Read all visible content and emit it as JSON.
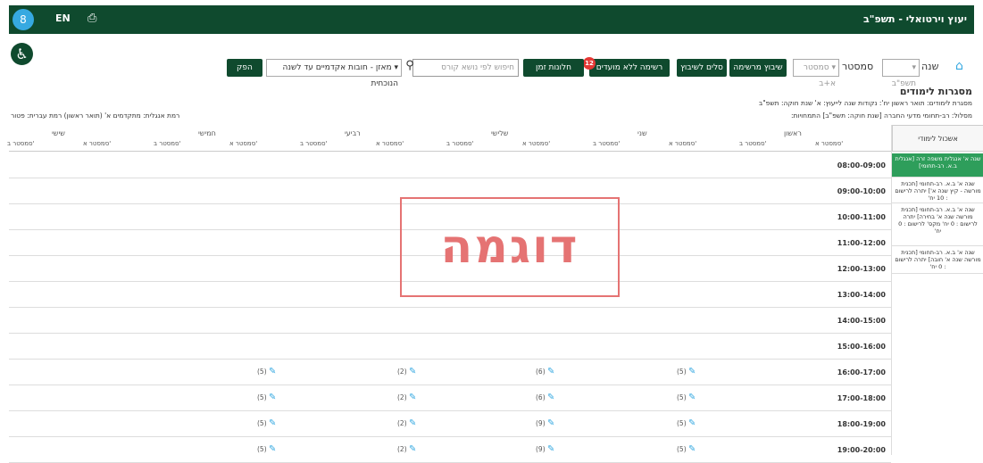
{
  "topbar": {
    "avatar": "8",
    "lang": "EN",
    "app_title": "יעוץ וירטואלי - תשפ\"ב"
  },
  "toolbar": {
    "year_label": "שנה",
    "year_value": "תשפ\"ב",
    "semester_label": "סמסטר",
    "semester_value": "סמסטר א+ב",
    "buttons": [
      "שיבוץ מרשימה",
      "סלים לשיבוץ",
      "רשימה ללא מועדים",
      "חלונות זמן"
    ],
    "badge": "12",
    "search_placeholder": "חיפוש לפי נושא קורס",
    "filter_value": "מאזן - חובות אקדמיים עד לשנה הנוכחית",
    "stop_label": "הפק"
  },
  "section": {
    "title": "מסגרות לימודים",
    "line1": "מסגרת לימודים: תואר ראשון  יח': נקודות  שנה לייעוץ: א'  שנת חוקה: תשפ\"ב",
    "line2": "מסלול: רב-תחומי מדעי החברה [שנת חוקה: תשפ\"ב]  התמחויות:",
    "line3_left": "רמת אנגלית: מתקדמים א' (תואר ראשון)   רמת עברית: פטור"
  },
  "sidebar": {
    "header": "אשכול לימודי",
    "cards": [
      {
        "text": "שנה א' אנגלית משפה זרה [אנגלית ב.א. רב-תחומי]",
        "selected": true
      },
      {
        "text": "שנה א' ב.א. רב-תחומי [תכנית מורשה - קיץ שנה א'] יתרה לרישום : 10 יח'",
        "selected": false
      },
      {
        "text": "שנה א' ב.א. רב-תחומי [תכנית מורשה שנה א' בחירה] יתרה לרישום : 0 יח' מקס' לרישום : 0 יח'",
        "selected": false
      },
      {
        "text": "שנה א' ב.א. רב-תחומי [תכנית מורשה שנה א' חובה] יתרה לרישום : 0 יח'",
        "selected": false
      }
    ]
  },
  "days": [
    {
      "name": "ראשון",
      "sem_a": "סמסטר א'",
      "sem_b": "סמסטר ב'"
    },
    {
      "name": "שני",
      "sem_a": "סמסטר א'",
      "sem_b": "סמסטר ב'"
    },
    {
      "name": "שלישי",
      "sem_a": "סמסטר א'",
      "sem_b": "סמסטר ב'"
    },
    {
      "name": "רביעי",
      "sem_a": "סמסטר א'",
      "sem_b": "סמסטר ב'"
    },
    {
      "name": "חמישי",
      "sem_a": "סמסטר א'",
      "sem_b": "סמסטר ב'"
    },
    {
      "name": "שישי",
      "sem_a": "סמסטר א'",
      "sem_b": "סמסטר ב'"
    }
  ],
  "rows": [
    {
      "time": "08:00-09:00",
      "cells": [
        "",
        "",
        "",
        "",
        ""
      ]
    },
    {
      "time": "09:00-10:00",
      "cells": [
        "",
        "",
        "",
        "",
        ""
      ]
    },
    {
      "time": "10:00-11:00",
      "cells": [
        "",
        "",
        "",
        "",
        ""
      ]
    },
    {
      "time": "11:00-12:00",
      "cells": [
        "",
        "",
        "",
        "",
        ""
      ]
    },
    {
      "time": "12:00-13:00",
      "cells": [
        "",
        "",
        "",
        "",
        ""
      ]
    },
    {
      "time": "13:00-14:00",
      "cells": [
        "",
        "",
        "",
        "",
        ""
      ]
    },
    {
      "time": "14:00-15:00",
      "cells": [
        "",
        "",
        "",
        "",
        ""
      ]
    },
    {
      "time": "15:00-16:00",
      "cells": [
        "",
        "",
        "",
        "",
        ""
      ]
    },
    {
      "time": "16:00-17:00",
      "cells": [
        "(5)",
        "(6)",
        "(2)",
        "(5)",
        ""
      ]
    },
    {
      "time": "17:00-18:00",
      "cells": [
        "(5)",
        "(6)",
        "(2)",
        "(5)",
        ""
      ]
    },
    {
      "time": "18:00-19:00",
      "cells": [
        "(5)",
        "(9)",
        "(2)",
        "(5)",
        ""
      ]
    },
    {
      "time": "19:00-20:00",
      "cells": [
        "(5)",
        "(9)",
        "(2)",
        "(5)",
        ""
      ]
    }
  ],
  "watermark": "דוגמה"
}
